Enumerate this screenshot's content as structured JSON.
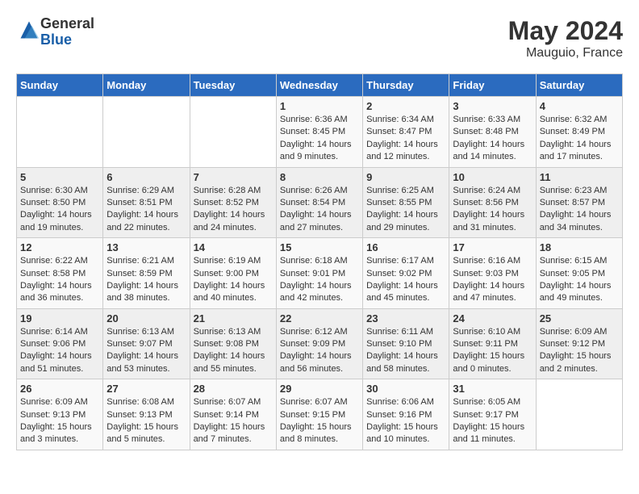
{
  "header": {
    "logo_line1": "General",
    "logo_line2": "Blue",
    "month": "May 2024",
    "location": "Mauguio, France"
  },
  "weekdays": [
    "Sunday",
    "Monday",
    "Tuesday",
    "Wednesday",
    "Thursday",
    "Friday",
    "Saturday"
  ],
  "weeks": [
    [
      {
        "day": "",
        "info": ""
      },
      {
        "day": "",
        "info": ""
      },
      {
        "day": "",
        "info": ""
      },
      {
        "day": "1",
        "info": "Sunrise: 6:36 AM\nSunset: 8:45 PM\nDaylight: 14 hours\nand 9 minutes."
      },
      {
        "day": "2",
        "info": "Sunrise: 6:34 AM\nSunset: 8:47 PM\nDaylight: 14 hours\nand 12 minutes."
      },
      {
        "day": "3",
        "info": "Sunrise: 6:33 AM\nSunset: 8:48 PM\nDaylight: 14 hours\nand 14 minutes."
      },
      {
        "day": "4",
        "info": "Sunrise: 6:32 AM\nSunset: 8:49 PM\nDaylight: 14 hours\nand 17 minutes."
      }
    ],
    [
      {
        "day": "5",
        "info": "Sunrise: 6:30 AM\nSunset: 8:50 PM\nDaylight: 14 hours\nand 19 minutes."
      },
      {
        "day": "6",
        "info": "Sunrise: 6:29 AM\nSunset: 8:51 PM\nDaylight: 14 hours\nand 22 minutes."
      },
      {
        "day": "7",
        "info": "Sunrise: 6:28 AM\nSunset: 8:52 PM\nDaylight: 14 hours\nand 24 minutes."
      },
      {
        "day": "8",
        "info": "Sunrise: 6:26 AM\nSunset: 8:54 PM\nDaylight: 14 hours\nand 27 minutes."
      },
      {
        "day": "9",
        "info": "Sunrise: 6:25 AM\nSunset: 8:55 PM\nDaylight: 14 hours\nand 29 minutes."
      },
      {
        "day": "10",
        "info": "Sunrise: 6:24 AM\nSunset: 8:56 PM\nDaylight: 14 hours\nand 31 minutes."
      },
      {
        "day": "11",
        "info": "Sunrise: 6:23 AM\nSunset: 8:57 PM\nDaylight: 14 hours\nand 34 minutes."
      }
    ],
    [
      {
        "day": "12",
        "info": "Sunrise: 6:22 AM\nSunset: 8:58 PM\nDaylight: 14 hours\nand 36 minutes."
      },
      {
        "day": "13",
        "info": "Sunrise: 6:21 AM\nSunset: 8:59 PM\nDaylight: 14 hours\nand 38 minutes."
      },
      {
        "day": "14",
        "info": "Sunrise: 6:19 AM\nSunset: 9:00 PM\nDaylight: 14 hours\nand 40 minutes."
      },
      {
        "day": "15",
        "info": "Sunrise: 6:18 AM\nSunset: 9:01 PM\nDaylight: 14 hours\nand 42 minutes."
      },
      {
        "day": "16",
        "info": "Sunrise: 6:17 AM\nSunset: 9:02 PM\nDaylight: 14 hours\nand 45 minutes."
      },
      {
        "day": "17",
        "info": "Sunrise: 6:16 AM\nSunset: 9:03 PM\nDaylight: 14 hours\nand 47 minutes."
      },
      {
        "day": "18",
        "info": "Sunrise: 6:15 AM\nSunset: 9:05 PM\nDaylight: 14 hours\nand 49 minutes."
      }
    ],
    [
      {
        "day": "19",
        "info": "Sunrise: 6:14 AM\nSunset: 9:06 PM\nDaylight: 14 hours\nand 51 minutes."
      },
      {
        "day": "20",
        "info": "Sunrise: 6:13 AM\nSunset: 9:07 PM\nDaylight: 14 hours\nand 53 minutes."
      },
      {
        "day": "21",
        "info": "Sunrise: 6:13 AM\nSunset: 9:08 PM\nDaylight: 14 hours\nand 55 minutes."
      },
      {
        "day": "22",
        "info": "Sunrise: 6:12 AM\nSunset: 9:09 PM\nDaylight: 14 hours\nand 56 minutes."
      },
      {
        "day": "23",
        "info": "Sunrise: 6:11 AM\nSunset: 9:10 PM\nDaylight: 14 hours\nand 58 minutes."
      },
      {
        "day": "24",
        "info": "Sunrise: 6:10 AM\nSunset: 9:11 PM\nDaylight: 15 hours\nand 0 minutes."
      },
      {
        "day": "25",
        "info": "Sunrise: 6:09 AM\nSunset: 9:12 PM\nDaylight: 15 hours\nand 2 minutes."
      }
    ],
    [
      {
        "day": "26",
        "info": "Sunrise: 6:09 AM\nSunset: 9:13 PM\nDaylight: 15 hours\nand 3 minutes."
      },
      {
        "day": "27",
        "info": "Sunrise: 6:08 AM\nSunset: 9:13 PM\nDaylight: 15 hours\nand 5 minutes."
      },
      {
        "day": "28",
        "info": "Sunrise: 6:07 AM\nSunset: 9:14 PM\nDaylight: 15 hours\nand 7 minutes."
      },
      {
        "day": "29",
        "info": "Sunrise: 6:07 AM\nSunset: 9:15 PM\nDaylight: 15 hours\nand 8 minutes."
      },
      {
        "day": "30",
        "info": "Sunrise: 6:06 AM\nSunset: 9:16 PM\nDaylight: 15 hours\nand 10 minutes."
      },
      {
        "day": "31",
        "info": "Sunrise: 6:05 AM\nSunset: 9:17 PM\nDaylight: 15 hours\nand 11 minutes."
      },
      {
        "day": "",
        "info": ""
      }
    ]
  ]
}
